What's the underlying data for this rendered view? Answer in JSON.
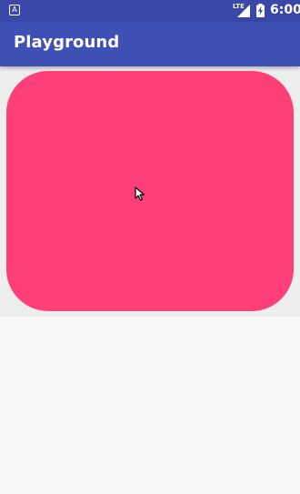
{
  "status_bar": {
    "app_icon_letter": "A",
    "network_label": "LTE",
    "time": "6:00"
  },
  "app_bar": {
    "title": "Playground"
  },
  "colors": {
    "status_bar": "#3948a8",
    "app_bar": "#3f51b5",
    "card": "#ff3f78",
    "content_background": "#eeeeef",
    "page_background": "#f8f7f9"
  },
  "icons": {
    "app_icon": "app-notification-icon",
    "signal": "cellular-signal-icon",
    "battery": "battery-charging-icon",
    "pointer": "mouse-cursor-icon"
  }
}
